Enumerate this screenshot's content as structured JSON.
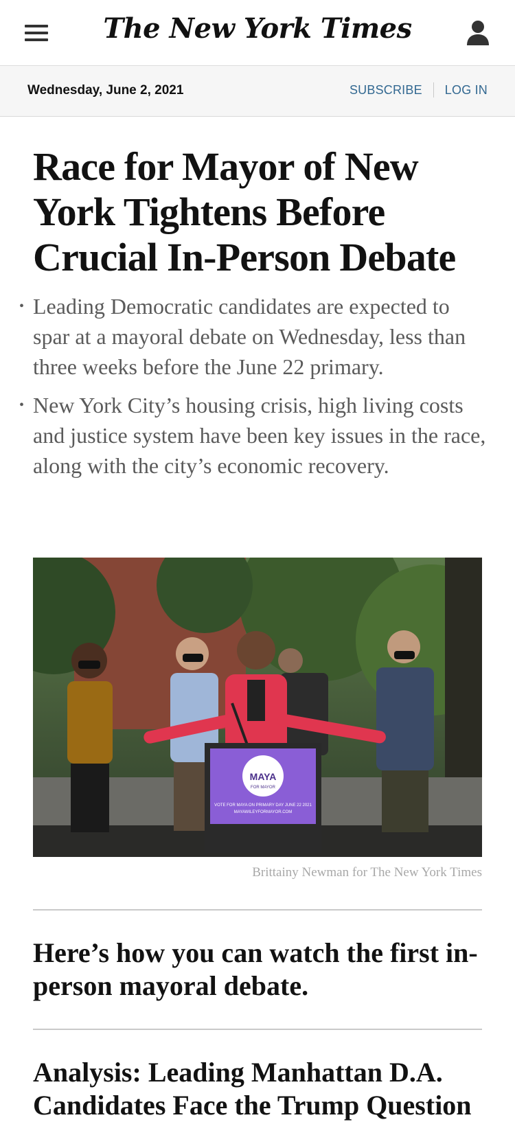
{
  "header": {
    "logo_text": "The New York Times",
    "menu_icon": "hamburger-menu-icon",
    "account_icon": "account-icon"
  },
  "date_strip": {
    "date": "Wednesday, June 2, 2021",
    "subscribe_label": "SUBSCRIBE",
    "login_label": "LOG IN",
    "link_color": "#326891"
  },
  "article": {
    "headline": "Race for Mayor of New York Tightens Before Crucial In-Person Debate",
    "summary": [
      "Leading Democratic candidates are expected to spar at a mayoral debate on Wednesday, less than three weeks before the June 22 primary.",
      "New York City’s housing crisis, high living costs and justice system have been key issues in the race, along with the city’s economic recovery."
    ],
    "photo_credit": "Brittainy Newman for The New York Times",
    "podium_sign": {
      "name": "MAYA",
      "sub": "FOR MAYOR",
      "line1": "VOTE FOR MAYA ON PRIMARY DAY JUNE 22 2021",
      "line2": "MAYAWILEYFORMAYOR.COM"
    }
  },
  "related": [
    "Here’s how you can watch the first in-person mayoral debate.",
    "Analysis: Leading Manhattan D.A. Candidates Face the Trump Question"
  ]
}
